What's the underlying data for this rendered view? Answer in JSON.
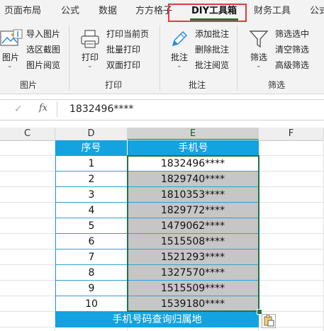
{
  "tabs": [
    "页面布局",
    "公式",
    "数据",
    "方方格子",
    "DIY工具箱",
    "财务工具",
    "公式"
  ],
  "active_tab": "DIY工具箱",
  "ribbon": {
    "groups": {
      "image": {
        "label": "图片",
        "big": "图片",
        "items": [
          "导入图片",
          "选区截图",
          "图片阅览"
        ]
      },
      "print": {
        "label": "打印",
        "big": "打印",
        "items": [
          "打印当前页",
          "批量打印",
          "双面打印"
        ]
      },
      "comment": {
        "label": "批注",
        "big": "批注",
        "items": [
          "添加批注",
          "删除批注",
          "批注阅览"
        ]
      },
      "filter": {
        "label": "筛选",
        "big": "筛选",
        "items": [
          "筛选选中",
          "清空筛选",
          "高级筛选"
        ]
      }
    }
  },
  "formula_bar": {
    "fx": "fx",
    "value": "1832496****"
  },
  "columns": [
    "C",
    "D",
    "E",
    "F"
  ],
  "table": {
    "headers": [
      "序号",
      "手机号"
    ],
    "rows": [
      [
        "1",
        "1832496****"
      ],
      [
        "2",
        "1829740****"
      ],
      [
        "3",
        "1810353****"
      ],
      [
        "4",
        "1829772****"
      ],
      [
        "5",
        "1479062****"
      ],
      [
        "6",
        "1515508****"
      ],
      [
        "7",
        "1521293****"
      ],
      [
        "8",
        "1327570****"
      ],
      [
        "9",
        "1515509****"
      ],
      [
        "10",
        "1539180****"
      ]
    ],
    "footer": "手机号码查询归属地"
  }
}
